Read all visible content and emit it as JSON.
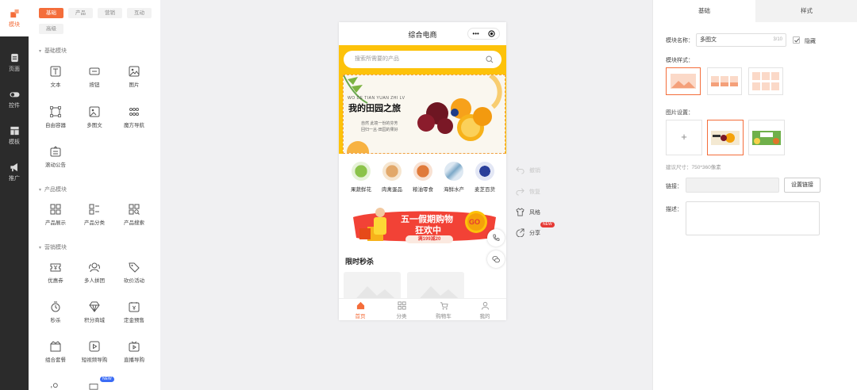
{
  "rail": {
    "items": [
      {
        "label": "模块",
        "icon": "module-icon",
        "active": true
      },
      {
        "label": "页面",
        "icon": "page-icon"
      },
      {
        "label": "控件",
        "icon": "toggle-icon"
      },
      {
        "label": "模板",
        "icon": "template-icon"
      },
      {
        "label": "推广",
        "icon": "megaphone-icon"
      }
    ]
  },
  "panel": {
    "tabs": [
      "基础",
      "产品",
      "营销",
      "互动",
      "高级"
    ],
    "sections": {
      "basic": "基础模块",
      "product": "产品模块",
      "marketing": "营销模块"
    },
    "basic_items": [
      "文本",
      "按钮",
      "图片",
      "自由容器",
      "多图文",
      "魔方导航",
      "滚动公告"
    ],
    "product_items": [
      "产品展示",
      "产品分类",
      "产品搜索"
    ],
    "marketing_items": [
      "优惠券",
      "多人拼团",
      "砍价活动",
      "秒杀",
      "积分商城",
      "定金预售",
      "组合套餐",
      "短视频导购",
      "直播导购"
    ],
    "new_badge": "NEW"
  },
  "phone": {
    "title": "综合电商",
    "capsule_dots": "•••",
    "search_placeholder": "搜索所需要的产品",
    "banner": {
      "pinyin": "WO DE TIAN YUAN ZHI LV",
      "title": "我的田园之旅",
      "line1": "自然 此境一份的芬芳",
      "line2": "回归一丛·田园的果好"
    },
    "categories": [
      "果蔬鲜花",
      "肉禽蛋品",
      "粮油零食",
      "海鲜水产",
      "麦芝百货"
    ],
    "promo": {
      "title_line1": "五一假期购物",
      "title_line2": "狂欢中",
      "deal": "满199减20",
      "go": "GO"
    },
    "seckill_title": "限时秒杀",
    "tabbar": [
      {
        "label": "首页",
        "active": true
      },
      {
        "label": "分类"
      },
      {
        "label": "购物车"
      },
      {
        "label": "我的"
      }
    ]
  },
  "side_actions": {
    "undo": "撤销",
    "redo": "恢复",
    "style": "风格",
    "share": "分享",
    "share_badge": "NEW"
  },
  "settings": {
    "tabs": [
      "基础",
      "样式"
    ],
    "name_label": "模块名称：",
    "name_value": "多图文",
    "name_count": "3/10",
    "hide_label": "隐藏",
    "style_label": "模块样式：",
    "image_label": "图片设置：",
    "add_glyph": "+",
    "size_hint": "建议尺寸：750*360像素",
    "link_label": "链接：",
    "link_button": "设置链接",
    "desc_label": "描述："
  },
  "colors": {
    "accent": "#f46d3a",
    "yellow": "#fdc20a",
    "rail": "#2b2b2b"
  }
}
